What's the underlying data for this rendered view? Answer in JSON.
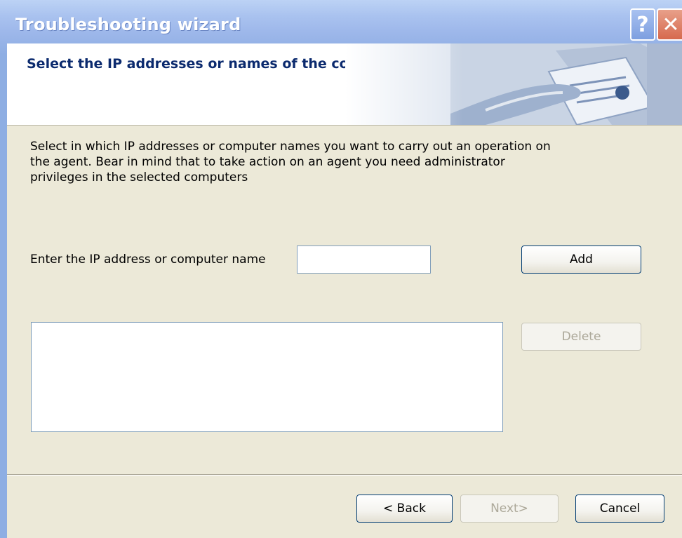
{
  "window": {
    "title": "Troubleshooting wizard",
    "help_glyph": "?",
    "close_glyph": "✕"
  },
  "header": {
    "title": "Select the IP addresses or names of the computers:"
  },
  "content": {
    "description": "Select in which IP addresses or computer names you want to carry out an operation on the agent. Bear in mind that to take action on an agent you need administrator privileges in the selected computers",
    "ip_label": "Enter the IP address or computer name",
    "ip_value": "",
    "add_label": "Add",
    "delete_label": "Delete",
    "computers": []
  },
  "footer": {
    "back_label": "< Back",
    "next_label": "Next>",
    "cancel_label": "Cancel"
  },
  "colors": {
    "titlebar": "#9db7ea",
    "header_title": "#0b2a6e",
    "body_bg": "#ece9d8"
  }
}
